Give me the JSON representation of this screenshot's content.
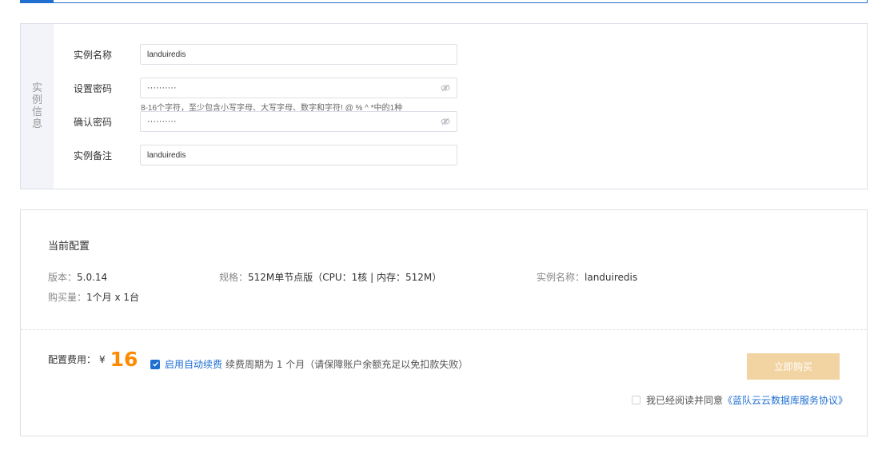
{
  "instance_info": {
    "side_title": "实例信息",
    "name_label": "实例名称",
    "name_value": "landuiredis",
    "password_label": "设置密码",
    "password_value": "··········",
    "password_hint": "8-16个字符，至少包含小写字母、大写字母、数字和字符! @ % ^ *中的1种",
    "confirm_label": "确认密码",
    "confirm_value": "··········",
    "remark_label": "实例备注",
    "remark_value": "landuiredis"
  },
  "config": {
    "title": "当前配置",
    "version_label": "版本：",
    "version_value": "5.0.14",
    "spec_label": "规格：",
    "spec_value": "512M单节点版（CPU：1核 | 内存：512M）",
    "instance_name_label": "实例名称：",
    "instance_name_value": "landuiredis",
    "quantity_label": "购买量：",
    "quantity_value": "1个月 x 1台"
  },
  "purchase": {
    "fee_label": "配置费用：",
    "currency": "¥",
    "amount": "16",
    "auto_renew_label": "启用自动续费",
    "auto_renew_desc": "续费周期为 1 个月（请保障账户余额充足以免扣款失败）",
    "buy_button": "立即购买",
    "agree_text": "我已经阅读并同意",
    "agree_link": "《蓝队云云数据库服务协议》"
  },
  "colors": {
    "accent": "#1f6fd1",
    "price": "#ff8a00",
    "buy_button_bg": "#f2d3a2"
  }
}
